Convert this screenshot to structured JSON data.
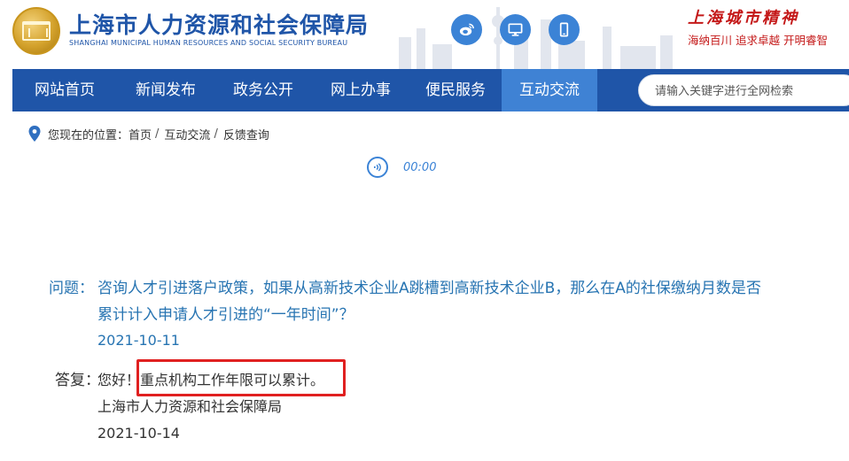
{
  "header": {
    "title": "上海市人力资源和社会保障局",
    "subtitle": "SHANGHAI MUNICIPAL HUMAN RESOURCES AND SOCIAL SECURITY BUREAU",
    "spirit_title": "上海城市精神",
    "spirit_subtitle": "海纳百川  追求卓越  开明睿智",
    "social_icons": [
      "weibo-icon",
      "desktop-icon",
      "mobile-icon"
    ],
    "brand_color": "#1f55a8",
    "spirit_color": "#c41818"
  },
  "nav": {
    "items": [
      {
        "label": "网站首页"
      },
      {
        "label": "新闻发布"
      },
      {
        "label": "政务公开"
      },
      {
        "label": "网上办事"
      },
      {
        "label": "便民服务"
      },
      {
        "label": "互动交流",
        "active": true
      }
    ],
    "search_placeholder": "请输入关键字进行全网检索",
    "active_color": "#3f82d4"
  },
  "breadcrumb": {
    "prefix": "您现在的位置：",
    "items": [
      "首页",
      "互动交流",
      "反馈查询"
    ],
    "separator": "/"
  },
  "audio": {
    "time": "00:00"
  },
  "question": {
    "label": "问题：",
    "line1": "咨询人才引进落户政策，如果从高新技术企业A跳槽到高新技术企业B，那么在A的社保缴纳月数是否",
    "line2": "累计计入申请人才引进的“一年时间”？",
    "date": "2021-10-11"
  },
  "answer": {
    "label": "答复：",
    "greeting": "您好！",
    "text": "重点机构工作年限可以累计。",
    "org": "上海市人力资源和社会保障局",
    "date": "2021-10-14",
    "highlight_color": "#e02020"
  }
}
